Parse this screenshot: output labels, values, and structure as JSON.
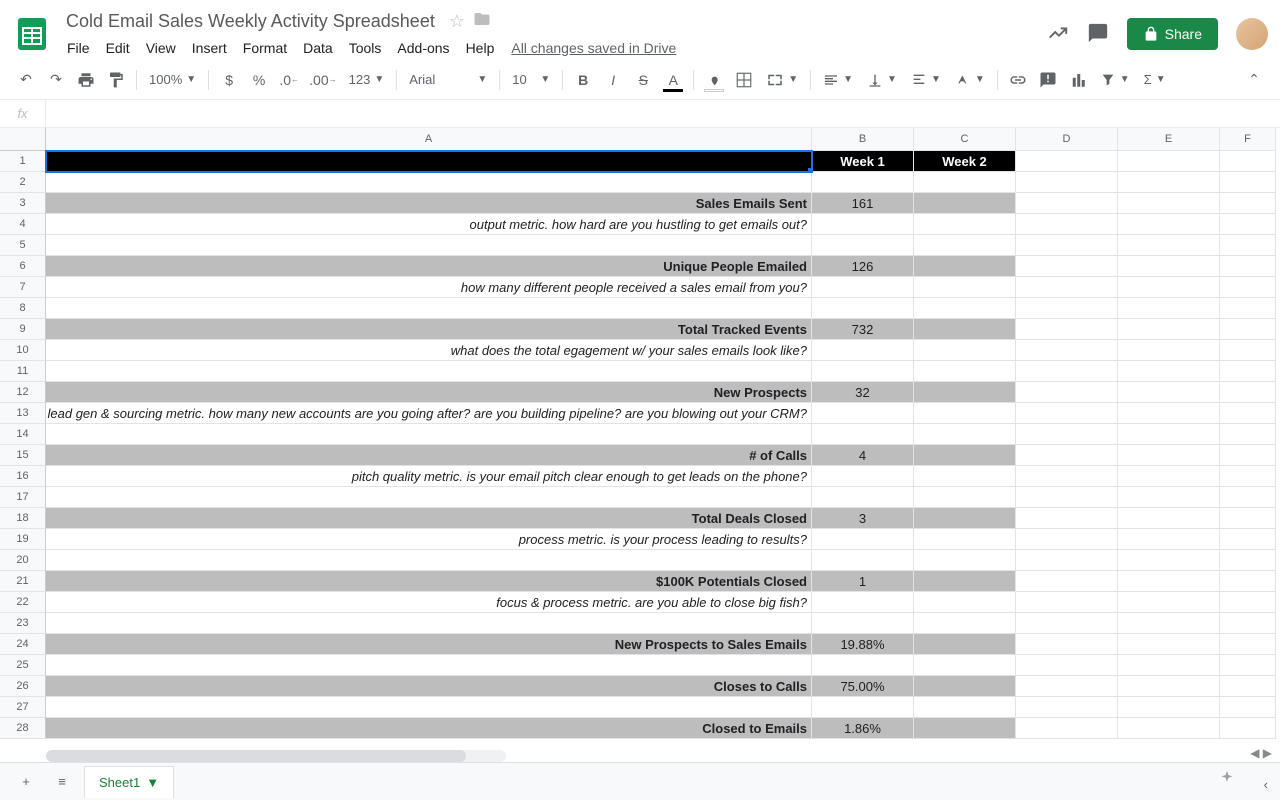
{
  "doc": {
    "title": "Cold Email Sales Weekly Activity Spreadsheet"
  },
  "menu": {
    "file": "File",
    "edit": "Edit",
    "view": "View",
    "insert": "Insert",
    "format": "Format",
    "data": "Data",
    "tools": "Tools",
    "addons": "Add-ons",
    "help": "Help",
    "save_status": "All changes saved in Drive"
  },
  "toolbar": {
    "zoom": "100%",
    "format_num": "123",
    "font": "Arial",
    "font_size": "10"
  },
  "share": {
    "label": "Share"
  },
  "columns": [
    "A",
    "B",
    "C",
    "D",
    "E",
    "F"
  ],
  "rows": [
    {
      "n": "1",
      "bg": "black",
      "a": "",
      "b": "Week 1",
      "c": "Week 2",
      "selected": true,
      "center": true
    },
    {
      "n": "2",
      "a": "",
      "b": "",
      "c": ""
    },
    {
      "n": "3",
      "bg": "grey",
      "a": "Sales Emails Sent",
      "b": "161",
      "c": "",
      "bold": true,
      "center": true
    },
    {
      "n": "4",
      "a": "output metric. how hard are you hustling to get emails out?",
      "b": "",
      "c": "",
      "italic": true
    },
    {
      "n": "5",
      "a": "",
      "b": "",
      "c": ""
    },
    {
      "n": "6",
      "bg": "grey",
      "a": "Unique People Emailed",
      "b": "126",
      "c": "",
      "bold": true,
      "center": true
    },
    {
      "n": "7",
      "a": "how many different people received a sales email from you?",
      "b": "",
      "c": "",
      "italic": true
    },
    {
      "n": "8",
      "a": "",
      "b": "",
      "c": ""
    },
    {
      "n": "9",
      "bg": "grey",
      "a": "Total Tracked Events",
      "b": "732",
      "c": "",
      "bold": true,
      "center": true
    },
    {
      "n": "10",
      "a": "what does the total egagement w/ your sales emails look like?",
      "b": "",
      "c": "",
      "italic": true
    },
    {
      "n": "11",
      "a": "",
      "b": "",
      "c": ""
    },
    {
      "n": "12",
      "bg": "grey",
      "a": "New Prospects",
      "b": "32",
      "c": "",
      "bold": true,
      "center": true
    },
    {
      "n": "13",
      "a": "lead gen & sourcing metric. how many new accounts are you going after? are you building pipeline? are you blowing out your CRM?",
      "b": "",
      "c": "",
      "italic": true
    },
    {
      "n": "14",
      "a": "",
      "b": "",
      "c": ""
    },
    {
      "n": "15",
      "bg": "grey",
      "a": "# of Calls",
      "b": "4",
      "c": "",
      "bold": true,
      "center": true
    },
    {
      "n": "16",
      "a": "pitch quality metric. is your email pitch clear enough to get leads on the phone?",
      "b": "",
      "c": "",
      "italic": true
    },
    {
      "n": "17",
      "a": "",
      "b": "",
      "c": ""
    },
    {
      "n": "18",
      "bg": "grey",
      "a": "Total Deals Closed",
      "b": "3",
      "c": "",
      "bold": true,
      "center": true
    },
    {
      "n": "19",
      "a": "process metric. is your process leading to results?",
      "b": "",
      "c": "",
      "italic": true
    },
    {
      "n": "20",
      "a": "",
      "b": "",
      "c": ""
    },
    {
      "n": "21",
      "bg": "grey",
      "a": "$100K Potentials Closed",
      "b": "1",
      "c": "",
      "bold": true,
      "center": true
    },
    {
      "n": "22",
      "a": "focus & process metric. are you able to close big fish?",
      "b": "",
      "c": "",
      "italic": true
    },
    {
      "n": "23",
      "a": "",
      "b": "",
      "c": ""
    },
    {
      "n": "24",
      "bg": "grey",
      "a": "New Prospects to Sales Emails",
      "b": "19.88%",
      "c": "",
      "bold": true,
      "center": true
    },
    {
      "n": "25",
      "a": "",
      "b": "",
      "c": ""
    },
    {
      "n": "26",
      "bg": "grey",
      "a": "Closes to Calls",
      "b": "75.00%",
      "c": "",
      "bold": true,
      "center": true
    },
    {
      "n": "27",
      "a": "",
      "b": "",
      "c": ""
    },
    {
      "n": "28",
      "bg": "grey",
      "a": "Closed to Emails",
      "b": "1.86%",
      "c": "",
      "bold": true,
      "center": true
    }
  ],
  "tabs": {
    "sheet1": "Sheet1"
  }
}
